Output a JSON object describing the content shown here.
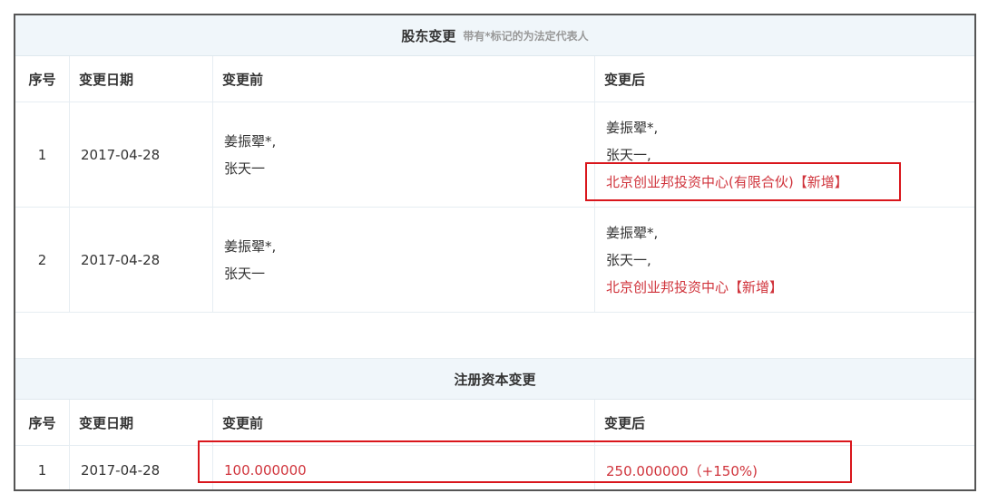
{
  "shareholder": {
    "title": "股东变更",
    "subtitle": "带有*标记的为法定代表人",
    "columns": [
      "序号",
      "变更日期",
      "变更前",
      "变更后"
    ],
    "rows": [
      {
        "no": "1",
        "date": "2017-04-28",
        "before": [
          "姜振翚*,",
          "张天一"
        ],
        "after": [
          "姜振翚*,",
          "张天一,"
        ],
        "after_new": "北京创业邦投资中心(有限合伙)【新增】"
      },
      {
        "no": "2",
        "date": "2017-04-28",
        "before": [
          "姜振翚*,",
          "张天一"
        ],
        "after": [
          "姜振翚*,",
          "张天一,"
        ],
        "after_new": "北京创业邦投资中心【新增】"
      }
    ]
  },
  "capital": {
    "title": "注册资本变更",
    "columns": [
      "序号",
      "变更日期",
      "变更前",
      "变更后"
    ],
    "rows": [
      {
        "no": "1",
        "date": "2017-04-28",
        "before": "100.000000",
        "after": "250.000000（+150%)"
      }
    ]
  },
  "colors": {
    "header_bg": "#f0f6fa",
    "highlight_text": "#d0343c",
    "annotation_box": "#d9161c"
  }
}
